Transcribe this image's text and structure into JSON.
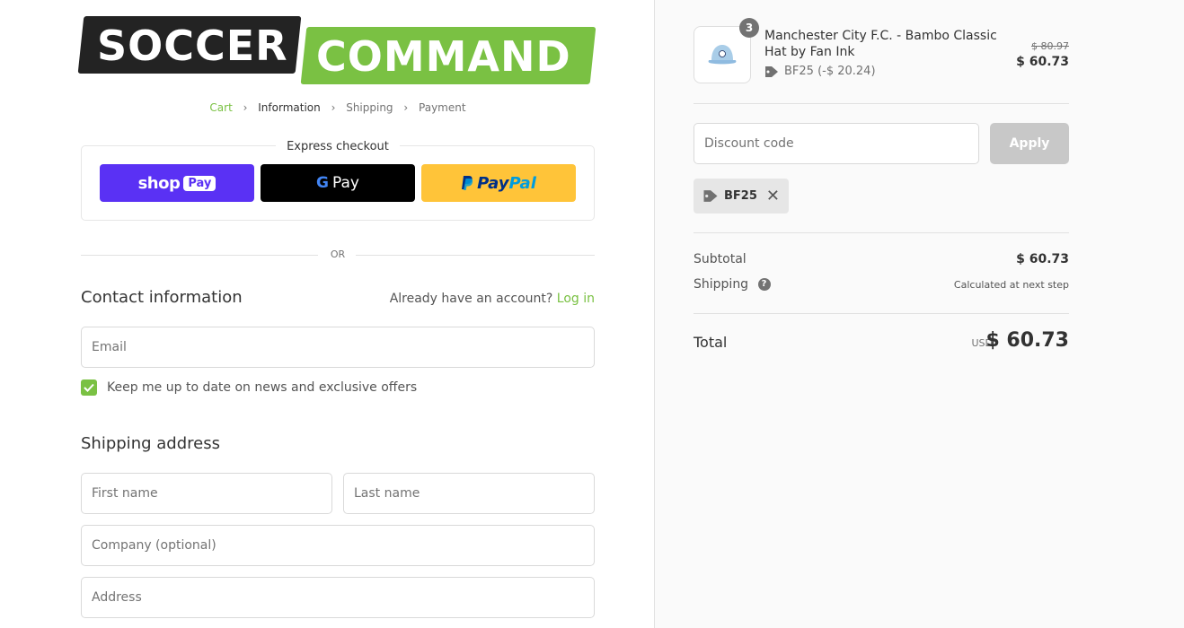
{
  "logo": {
    "word1": "SOCCER",
    "word2": "COMMAND"
  },
  "breadcrumb": {
    "cart": "Cart",
    "information": "Information",
    "shipping": "Shipping",
    "payment": "Payment"
  },
  "express": {
    "title": "Express checkout",
    "shop_pay": {
      "word": "shop",
      "badge": "Pay"
    },
    "gpay": {
      "g": "G",
      "label": "Pay"
    },
    "paypal": {
      "pay": "Pay",
      "pal": "Pal"
    }
  },
  "divider": {
    "or": "OR"
  },
  "contact": {
    "title": "Contact information",
    "account_prompt": "Already have an account?",
    "login": "Log in",
    "email_placeholder": "Email",
    "newsletter_label": "Keep me up to date on news and exclusive offers",
    "newsletter_checked": true
  },
  "shipping_address": {
    "title": "Shipping address",
    "first_name_placeholder": "First name",
    "last_name_placeholder": "Last name",
    "company_placeholder": "Company (optional)",
    "address_placeholder": "Address"
  },
  "order": {
    "product": {
      "quantity": "3",
      "name": "Manchester City F.C. - Bambo Classic Hat by Fan Ink",
      "discount": "BF25 (-$ 20.24)",
      "price_original": "$ 80.97",
      "price_final": "$ 60.73"
    },
    "discount_code": {
      "placeholder": "Discount code",
      "apply": "Apply",
      "applied_code": "BF25"
    },
    "summary": {
      "subtotal_label": "Subtotal",
      "subtotal_value": "$ 60.73",
      "shipping_label": "Shipping",
      "shipping_value": "Calculated at next step",
      "total_label": "Total",
      "currency": "USD",
      "total_value": "$ 60.73"
    }
  },
  "colors": {
    "accent": "#7ac143",
    "shop_pay": "#5a31f4",
    "paypal": "#ffc439",
    "logo_dark": "#232323"
  }
}
